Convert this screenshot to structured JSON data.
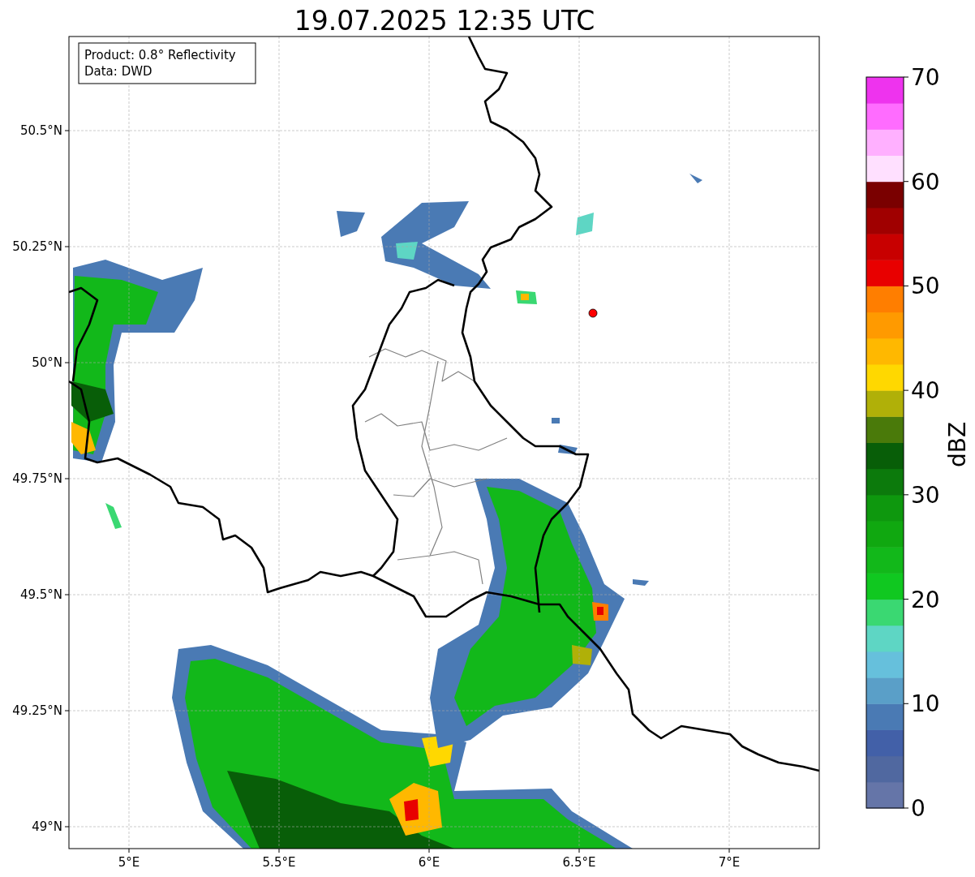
{
  "title": "19.07.2025 12:35 UTC",
  "legend": {
    "lines": [
      "Product: 0.8° Reflectivity",
      "Data: DWD"
    ]
  },
  "map": {
    "xticks": [
      "5°E",
      "5.5°E",
      "6°E",
      "6.5°E",
      "7°E"
    ],
    "yticks": [
      "50.5°N",
      "50.25°N",
      "50°N",
      "49.75°N",
      "49.5°N",
      "49.25°N",
      "49°N"
    ]
  },
  "colorbar": {
    "label": "dBZ",
    "ticks": [
      "70",
      "60",
      "50",
      "40",
      "30",
      "20",
      "10",
      "0"
    ],
    "segments": [
      {
        "color": "#6575a8"
      },
      {
        "color": "#5068a0"
      },
      {
        "color": "#4260a8"
      },
      {
        "color": "#4a7ab4"
      },
      {
        "color": "#5a9fc8"
      },
      {
        "color": "#66c0dc"
      },
      {
        "color": "#5ed6c4"
      },
      {
        "color": "#3ad872"
      },
      {
        "color": "#10c820"
      },
      {
        "color": "#12b81a"
      },
      {
        "color": "#10a810"
      },
      {
        "color": "#0e980e"
      },
      {
        "color": "#0c7a0c"
      },
      {
        "color": "#085e08"
      },
      {
        "color": "#4a7a0a"
      },
      {
        "color": "#b0b008"
      },
      {
        "color": "#ffd800"
      },
      {
        "color": "#ffb800"
      },
      {
        "color": "#ff9a00"
      },
      {
        "color": "#ff7e00"
      },
      {
        "color": "#e80000"
      },
      {
        "color": "#c80000"
      },
      {
        "color": "#a00000"
      },
      {
        "color": "#7a0000"
      },
      {
        "color": "#ffe0ff"
      },
      {
        "color": "#ffb0ff"
      },
      {
        "color": "#ff6cff"
      },
      {
        "color": "#ee33ee"
      }
    ]
  }
}
